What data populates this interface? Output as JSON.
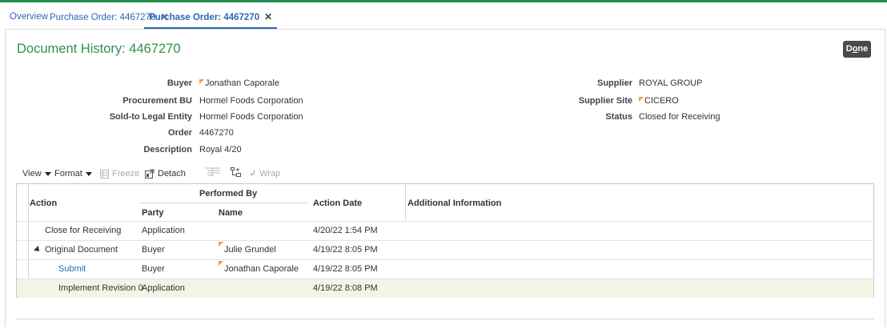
{
  "tabs": [
    {
      "label": "Overview",
      "closable": false
    },
    {
      "label": "Purchase Order: 4467270",
      "closable": true
    },
    {
      "label": "Purchase Order: 4467270",
      "closable": true,
      "active": true
    }
  ],
  "page": {
    "title": "Document History: 4467270",
    "done_label_pre": "D",
    "done_label_ul": "o",
    "done_label_post": "ne"
  },
  "header_fields": {
    "left": [
      {
        "label": "Buyer",
        "value": "Jonathan Caporale",
        "flag": true
      },
      {
        "label": "Procurement BU",
        "value": "Hormel Foods Corporation"
      },
      {
        "label": "Sold-to Legal Entity",
        "value": "Hormel Foods Corporation"
      },
      {
        "label": "Order",
        "value": "4467270"
      },
      {
        "label": "Description",
        "value": "Royal 4/20"
      }
    ],
    "right": [
      {
        "label": "Supplier",
        "value": "ROYAL GROUP"
      },
      {
        "label": "Supplier Site",
        "value": "CICERO",
        "flag": true
      },
      {
        "label": "Status",
        "value": "Closed for Receiving"
      }
    ]
  },
  "toolbar": {
    "view": "View",
    "format": "Format",
    "freeze": "Freeze",
    "detach": "Detach",
    "wrap": "Wrap"
  },
  "table": {
    "headers": {
      "action": "Action",
      "performed_by": "Performed By",
      "party": "Party",
      "name": "Name",
      "action_date": "Action Date",
      "additional_info": "Additional Information"
    },
    "rows": [
      {
        "action": "Close for Receiving",
        "party": "Application",
        "name": "",
        "date": "4/20/22 1:54 PM",
        "info": ""
      },
      {
        "action": "Original Document",
        "party": "Buyer",
        "name": "Julie Grundel",
        "date": "4/19/22 8:05 PM",
        "info": "",
        "expanded": true
      },
      {
        "action": "Submit",
        "party": "Buyer",
        "name": "Jonathan Caporale",
        "date": "4/19/22 8:05 PM",
        "info": "",
        "link": true
      },
      {
        "action": "Implement Revision 0",
        "party": "Application",
        "name": "",
        "date": "4/19/22 8:08 PM",
        "info": "",
        "selected": true
      }
    ]
  },
  "colors": {
    "brand_green": "#1f8b4c",
    "title_green": "#2f8f4f",
    "link_blue": "#2a6ab2",
    "flag_orange": "#f39c4a",
    "selected_row": "#f4f4e6"
  }
}
